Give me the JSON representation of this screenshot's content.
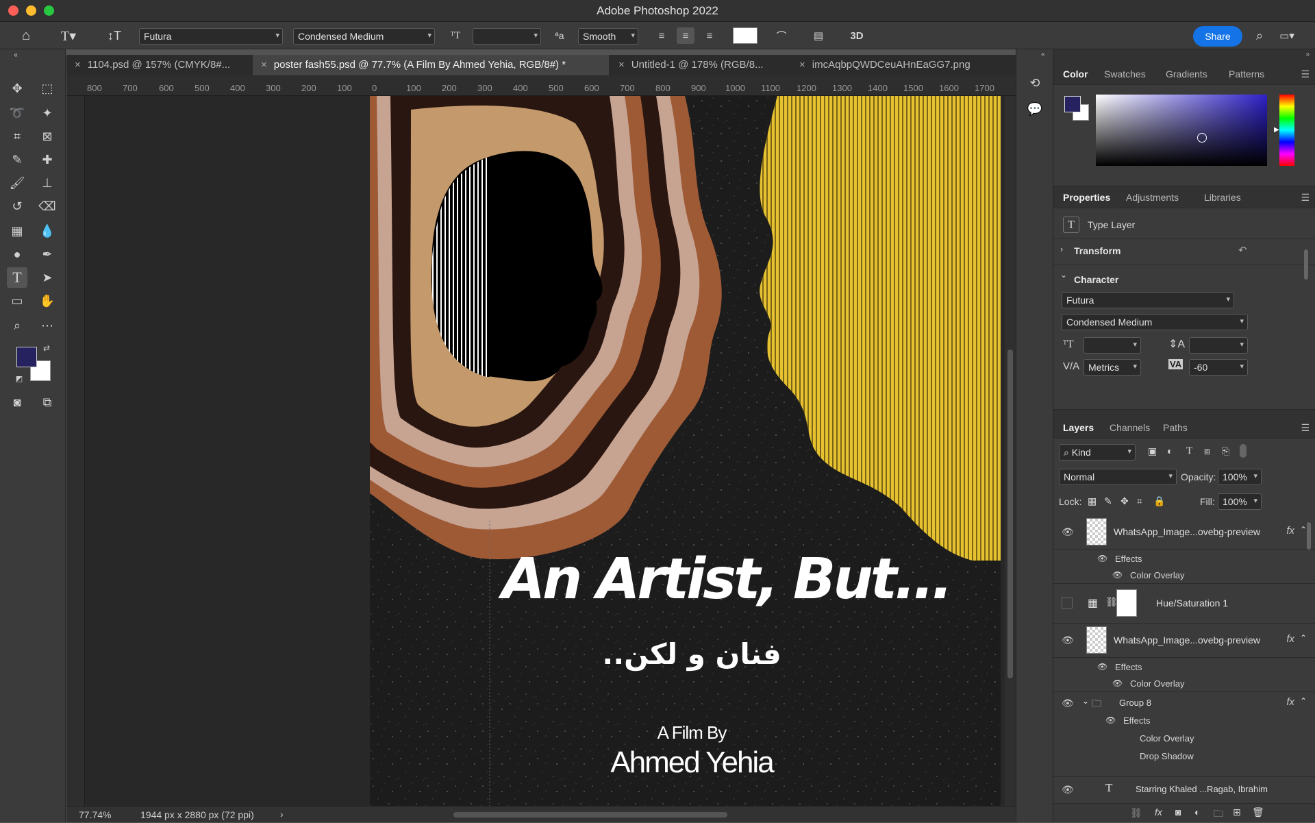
{
  "window": {
    "title": "Adobe Photoshop 2022"
  },
  "options_bar": {
    "font_family": "Futura",
    "font_style": "Condensed Medium",
    "antialias": "Smooth",
    "three_d": "3D",
    "share": "Share"
  },
  "tabs": [
    {
      "label": "1104.psd @ 157% (CMYK/8#..."
    },
    {
      "label": "poster fash55.psd @ 77.7% (A Film By Ahmed Yehia, RGB/8#) *"
    },
    {
      "label": "Untitled-1 @ 178% (RGB/8..."
    },
    {
      "label": "imcAqbpQWDCeuAHnEaGG7.png"
    }
  ],
  "ruler_labels": [
    "800",
    "700",
    "600",
    "500",
    "400",
    "300",
    "200",
    "100",
    "0",
    "100",
    "200",
    "300",
    "400",
    "500",
    "600",
    "700",
    "800",
    "900",
    "1000",
    "1100",
    "1200",
    "1300",
    "1400",
    "1500",
    "1600",
    "1700"
  ],
  "poster": {
    "title": "An Artist, But...",
    "arabic": "..فنان و لكن",
    "film_by": "A Film By",
    "director": "Ahmed Yehia"
  },
  "status": {
    "zoom": "77.74%",
    "doc_size": "1944 px x 2880 px (72 ppi)"
  },
  "color_panel": {
    "tabs": [
      "Color",
      "Swatches",
      "Gradients",
      "Patterns"
    ],
    "foreground": "#26215f"
  },
  "properties_panel": {
    "tabs": [
      "Properties",
      "Adjustments",
      "Libraries"
    ],
    "layer_type": "Type Layer",
    "transform": "Transform",
    "character": "Character",
    "font_family": "Futura",
    "font_style": "Condensed Medium",
    "kerning": "Metrics",
    "tracking": "-60"
  },
  "layers_panel": {
    "tabs": [
      "Layers",
      "Channels",
      "Paths"
    ],
    "filter": "Kind",
    "blend_mode": "Normal",
    "opacity_label": "Opacity:",
    "opacity": "100%",
    "lock_label": "Lock:",
    "fill_label": "Fill:",
    "fill": "100%",
    "rows": [
      {
        "name": "WhatsApp_Image...ovebg-preview"
      },
      {
        "name": "Effects"
      },
      {
        "name": "Color Overlay"
      },
      {
        "name": "Hue/Saturation 1"
      },
      {
        "name": "WhatsApp_Image...ovebg-preview"
      },
      {
        "name": "Effects"
      },
      {
        "name": "Color Overlay"
      },
      {
        "name": "Group 8"
      },
      {
        "name": "Effects"
      },
      {
        "name": "Color Overlay"
      },
      {
        "name": "Drop Shadow"
      },
      {
        "name": "Starring Khaled ...Ragab, Ibrahim"
      }
    ]
  }
}
